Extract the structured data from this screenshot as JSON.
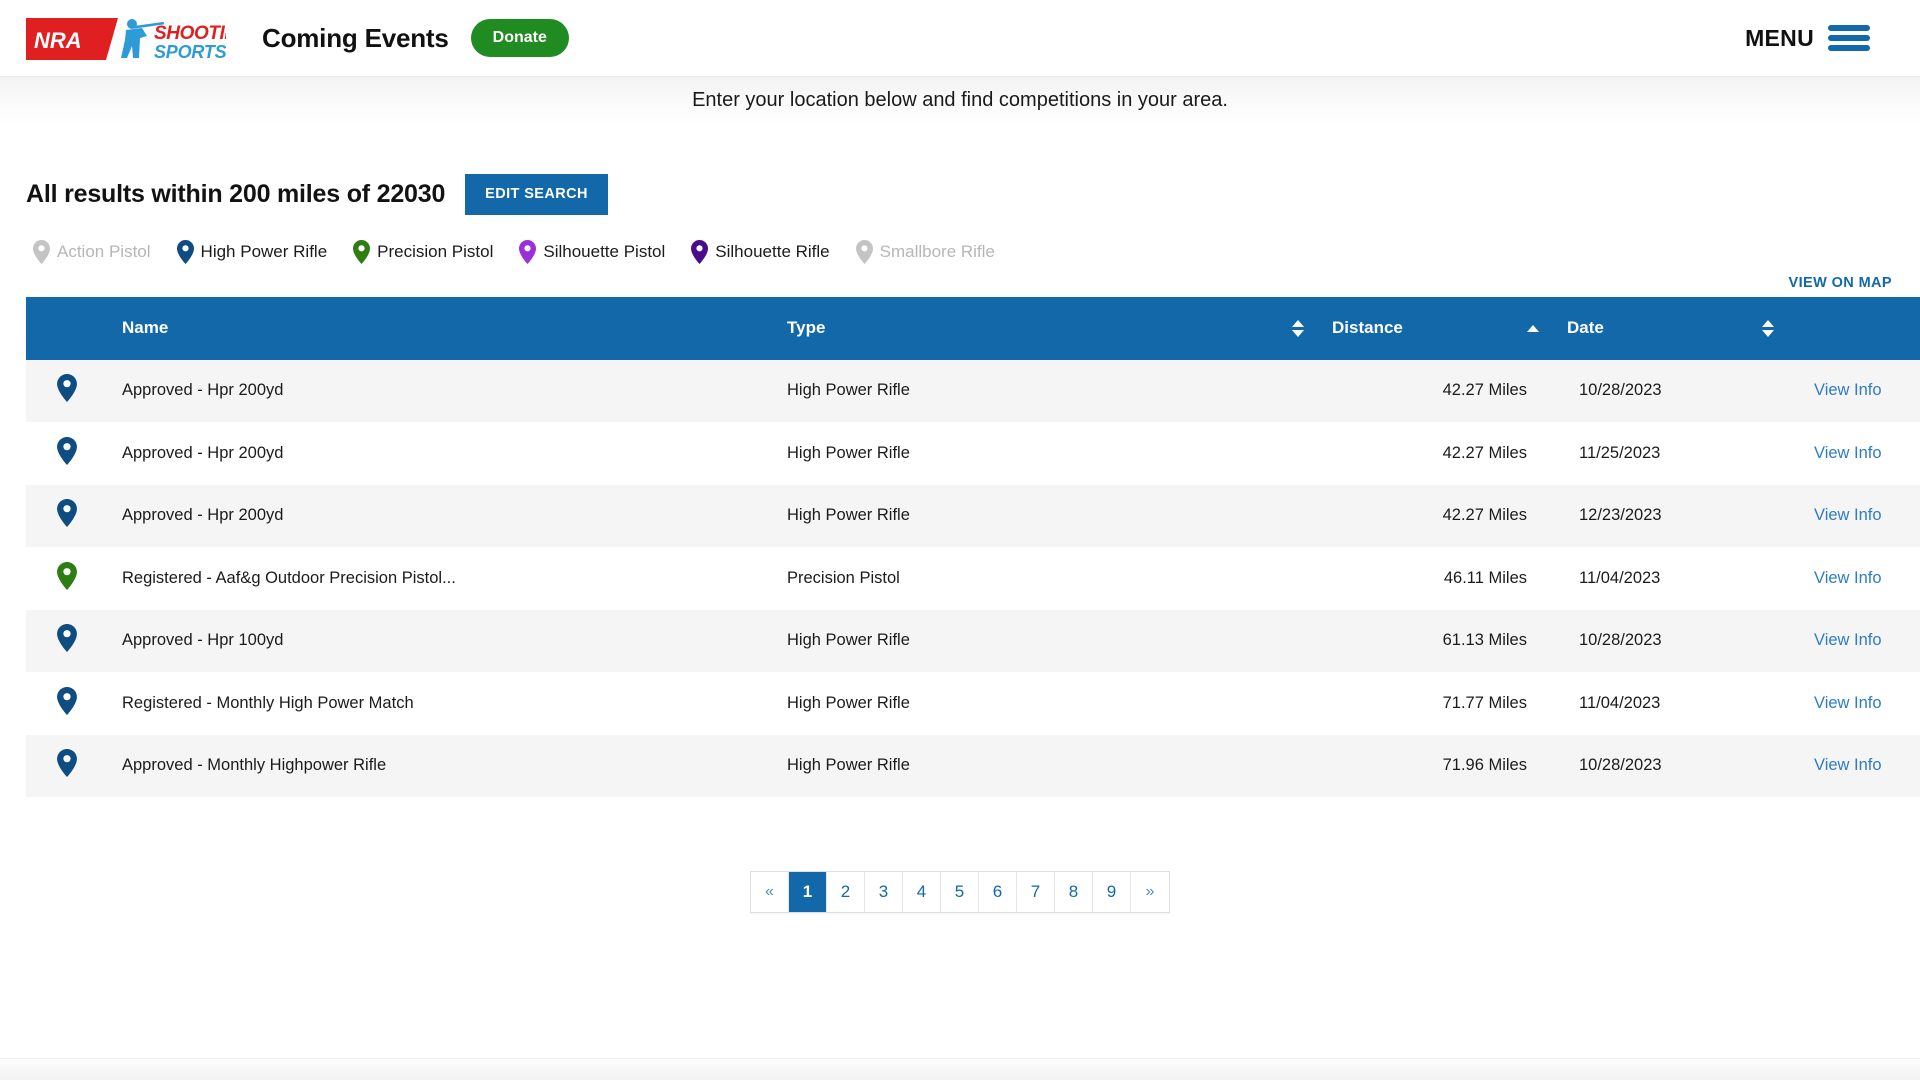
{
  "header": {
    "logo_alt": "NRA Shooting Sports USA",
    "logo_nra": "NRA",
    "logo_line1": "SHOOTING",
    "logo_line2": "SPORTS USA",
    "page_title": "Coming Events",
    "donate_label": "Donate",
    "menu_label": "MENU"
  },
  "subtitle": {
    "text": "Enter your location below and find competitions in your area."
  },
  "search": {
    "results_title": "All results within 200 miles of 22030",
    "edit_search_label": "EDIT SEARCH",
    "radius_miles": "200",
    "zip": "22030"
  },
  "legend": {
    "items": [
      {
        "label": "Action Pistol",
        "color": "#c4c4c4",
        "active": false
      },
      {
        "label": "High Power Rifle",
        "color": "#0F4C81",
        "active": true
      },
      {
        "label": "Precision Pistol",
        "color": "#2E7D13",
        "active": true
      },
      {
        "label": "Silhouette Pistol",
        "color": "#9B30D9",
        "active": true
      },
      {
        "label": "Silhouette Rifle",
        "color": "#4B0C8C",
        "active": true
      },
      {
        "label": "Smallbore Rifle",
        "color": "#c4c4c4",
        "active": false
      }
    ]
  },
  "map": {
    "view_on_map_label": "VIEW ON MAP"
  },
  "table": {
    "columns": {
      "name": "Name",
      "type": "Type",
      "distance": "Distance",
      "date": "Date"
    },
    "sort": {
      "type_state": "none",
      "distance_state": "asc",
      "date_state": "none"
    },
    "action_label": "View Info",
    "rows": [
      {
        "pin_color": "#0F4C81",
        "name": "Approved - Hpr 200yd",
        "type": "High Power Rifle",
        "distance": "42.27 Miles",
        "date": "10/28/2023",
        "action": "View Info"
      },
      {
        "pin_color": "#0F4C81",
        "name": "Approved - Hpr 200yd",
        "type": "High Power Rifle",
        "distance": "42.27 Miles",
        "date": "11/25/2023",
        "action": "View Info"
      },
      {
        "pin_color": "#0F4C81",
        "name": "Approved - Hpr 200yd",
        "type": "High Power Rifle",
        "distance": "42.27 Miles",
        "date": "12/23/2023",
        "action": "View Info"
      },
      {
        "pin_color": "#2E7D13",
        "name": "Registered - Aaf&g Outdoor Precision Pistol...",
        "type": "Precision Pistol",
        "distance": "46.11 Miles",
        "date": "11/04/2023",
        "action": "View Info"
      },
      {
        "pin_color": "#0F4C81",
        "name": "Approved - Hpr 100yd",
        "type": "High Power Rifle",
        "distance": "61.13 Miles",
        "date": "10/28/2023",
        "action": "View Info"
      },
      {
        "pin_color": "#0F4C81",
        "name": "Registered - Monthly High Power Match",
        "type": "High Power Rifle",
        "distance": "71.77 Miles",
        "date": "11/04/2023",
        "action": "View Info"
      },
      {
        "pin_color": "#0F4C81",
        "name": "Approved - Monthly Highpower Rifle",
        "type": "High Power Rifle",
        "distance": "71.96 Miles",
        "date": "10/28/2023",
        "action": "View Info"
      }
    ]
  },
  "pagination": {
    "prev_label": "«",
    "next_label": "»",
    "pages": [
      "1",
      "2",
      "3",
      "4",
      "5",
      "6",
      "7",
      "8",
      "9"
    ],
    "current_page": "1"
  },
  "colors": {
    "accent_blue": "#1268A8",
    "link_blue": "#2E7CC4",
    "donate_green": "#208B20",
    "row_odd": "#f5f5f5",
    "row_even": "#ffffff"
  }
}
